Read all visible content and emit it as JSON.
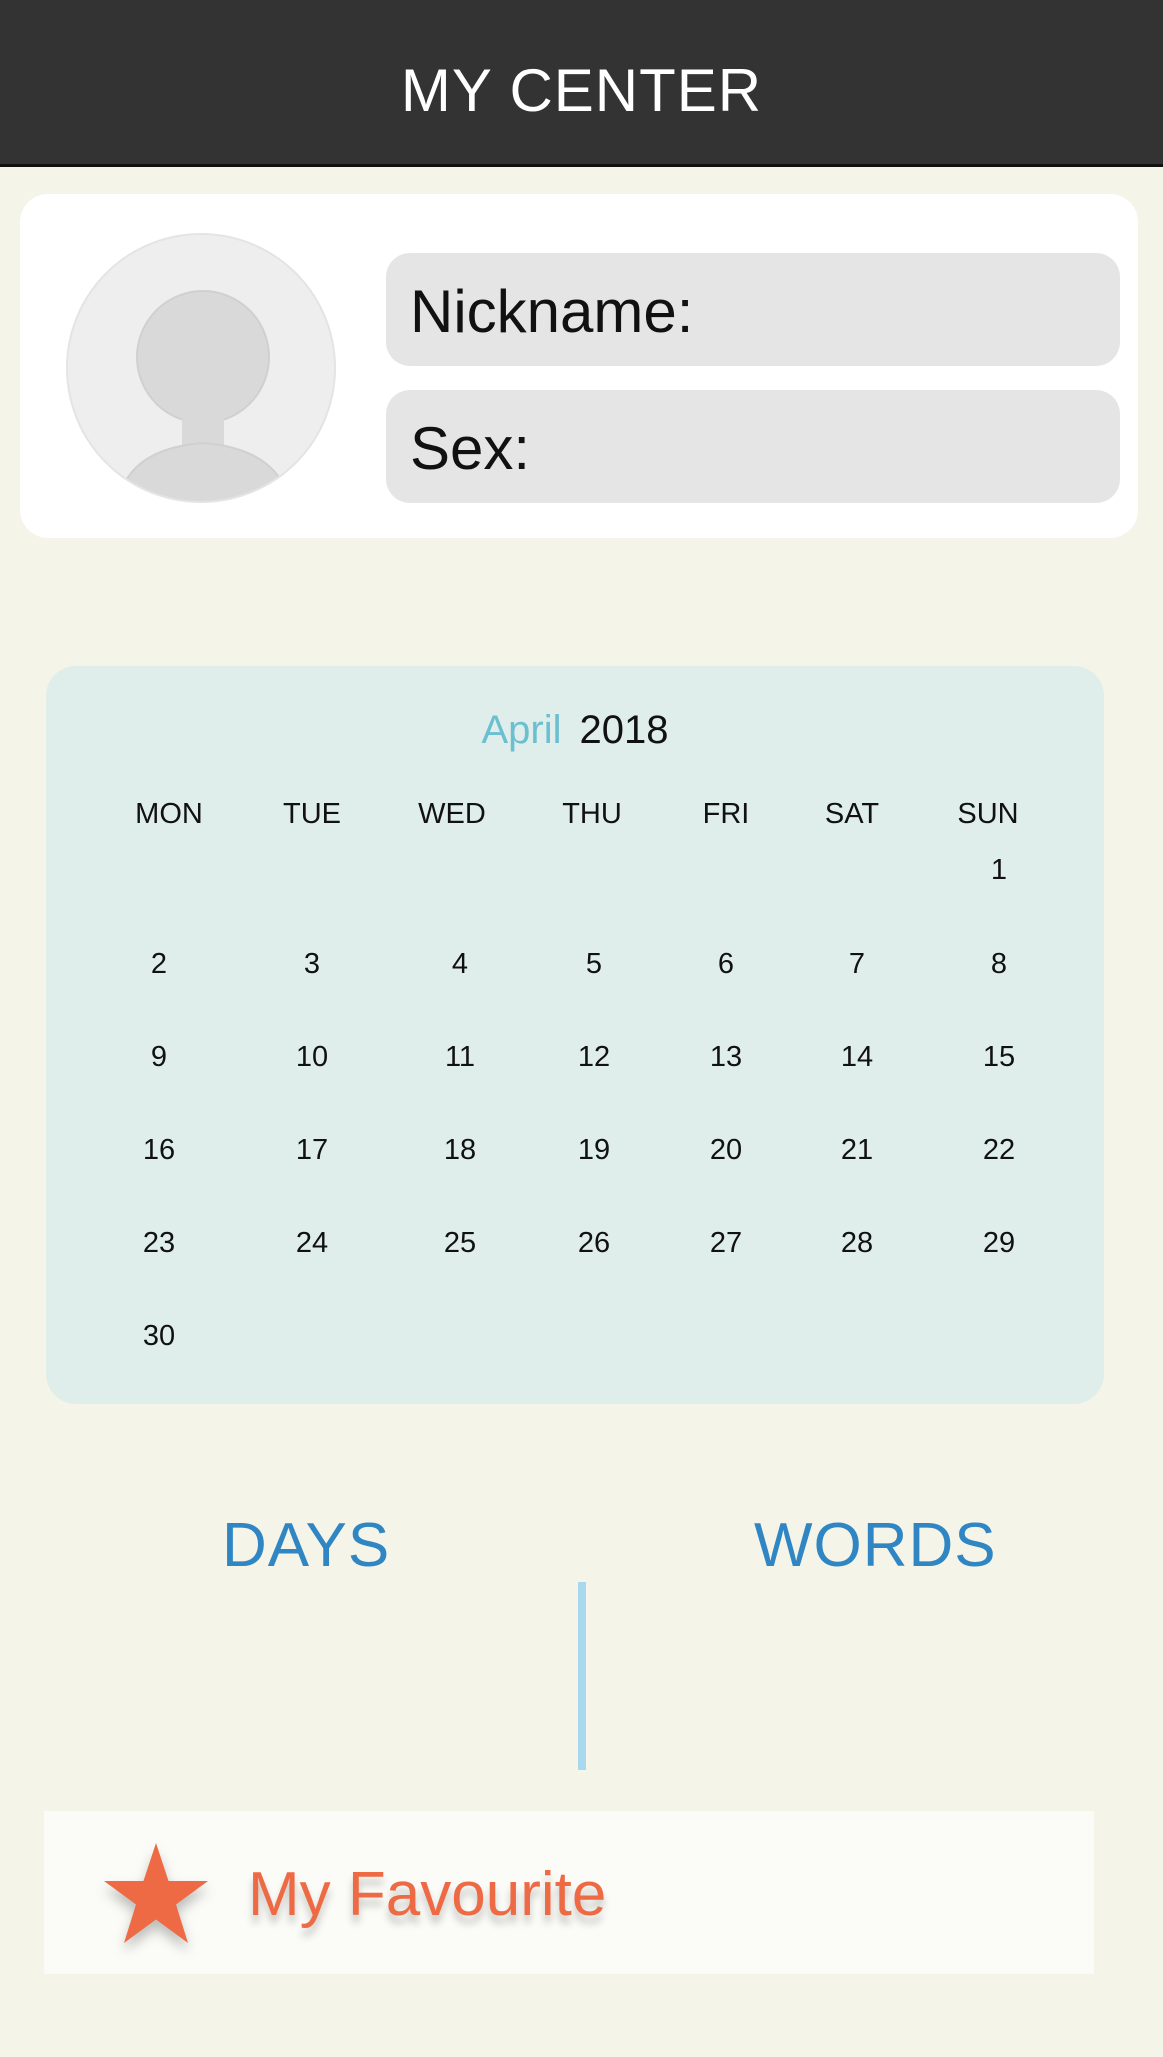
{
  "header": {
    "title": "MY CENTER"
  },
  "profile": {
    "nickname_label": "Nickname:",
    "sex_label": "Sex:"
  },
  "calendar": {
    "month": "April",
    "year": "2018",
    "weekdays": [
      "MON",
      "TUE",
      "WED",
      "THU",
      "FRI",
      "SAT",
      "SUN"
    ],
    "days": [
      "1",
      "2",
      "3",
      "4",
      "5",
      "6",
      "7",
      "8",
      "9",
      "10",
      "11",
      "12",
      "13",
      "14",
      "15",
      "16",
      "17",
      "18",
      "19",
      "20",
      "21",
      "22",
      "23",
      "24",
      "25",
      "26",
      "27",
      "28",
      "29",
      "30"
    ]
  },
  "stats": {
    "days_label": "DAYS",
    "words_label": "WORDS"
  },
  "favourite": {
    "label": "My Favourite"
  },
  "colors": {
    "header_bg": "#333333",
    "page_bg": "#f4f4e9",
    "calendar_bg": "#dfeeea",
    "month_accent": "#6bbfd0",
    "stat_blue": "#2f86c3",
    "divider": "#a9d8ef",
    "favourite_orange": "#ee6a44"
  },
  "icons": {
    "avatar": "user-avatar-placeholder-icon",
    "favourite": "star-icon"
  }
}
